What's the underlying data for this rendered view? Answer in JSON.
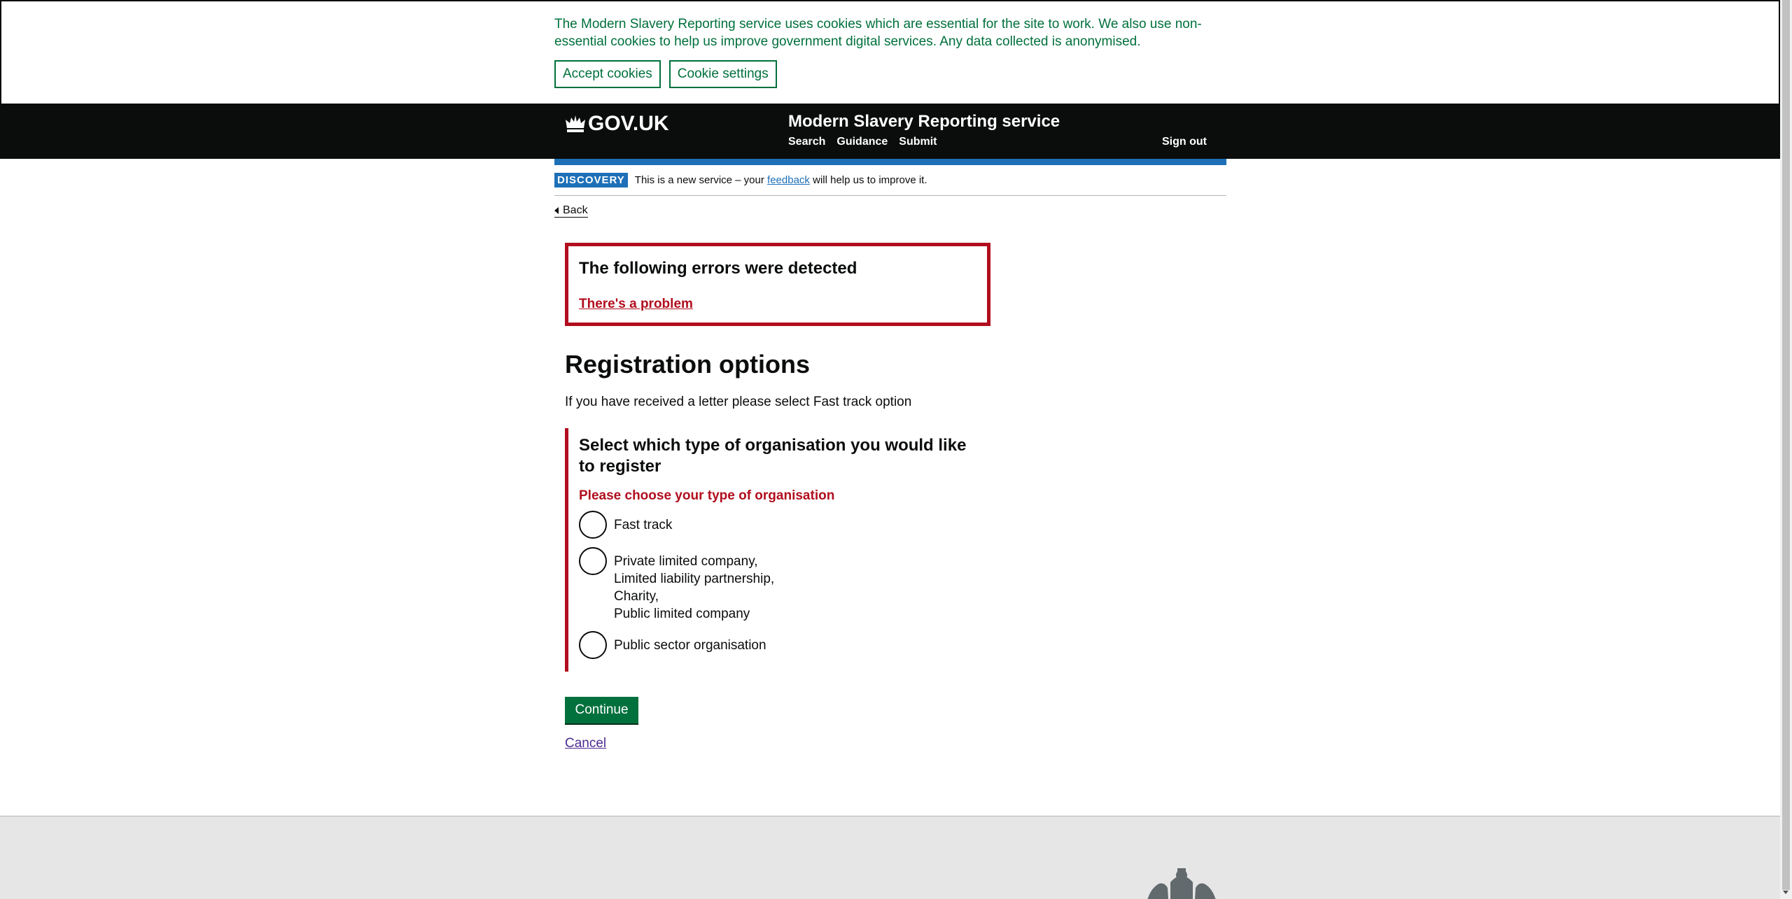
{
  "cookie_banner": {
    "text": "The Modern Slavery Reporting service uses cookies which are essential for the site to work. We also use non-essential cookies to help us improve government digital services. Any data collected is anonymised.",
    "accept_label": "Accept cookies",
    "settings_label": "Cookie settings"
  },
  "header": {
    "logo_text": "GOV.UK",
    "service_name": "Modern Slavery Reporting service",
    "nav": [
      "Search",
      "Guidance",
      "Submit"
    ],
    "sign_out": "Sign out"
  },
  "phase_banner": {
    "tag": "DISCOVERY",
    "text_before": "This is a new service – your ",
    "link": "feedback",
    "text_after": " will help us to improve it."
  },
  "back_label": "Back",
  "error_summary": {
    "title": "The following errors were detected",
    "link": "There's a problem"
  },
  "page": {
    "title": "Registration options",
    "hint": "If you have received a letter please select Fast track option"
  },
  "form": {
    "legend": "Select which type of organisation you would like to register",
    "error": "Please choose your type of organisation",
    "options": [
      {
        "lines": [
          "Fast track"
        ]
      },
      {
        "lines": [
          "Private limited company,",
          "Limited liability partnership,",
          "Charity,",
          "Public limited company"
        ]
      },
      {
        "lines": [
          "Public sector organisation"
        ]
      }
    ]
  },
  "continue_label": "Continue",
  "cancel_label": "Cancel",
  "colors": {
    "error": "#b10e1e",
    "button": "#00703c",
    "header": "#0b0c0c",
    "brand_blue": "#1d70b8"
  }
}
